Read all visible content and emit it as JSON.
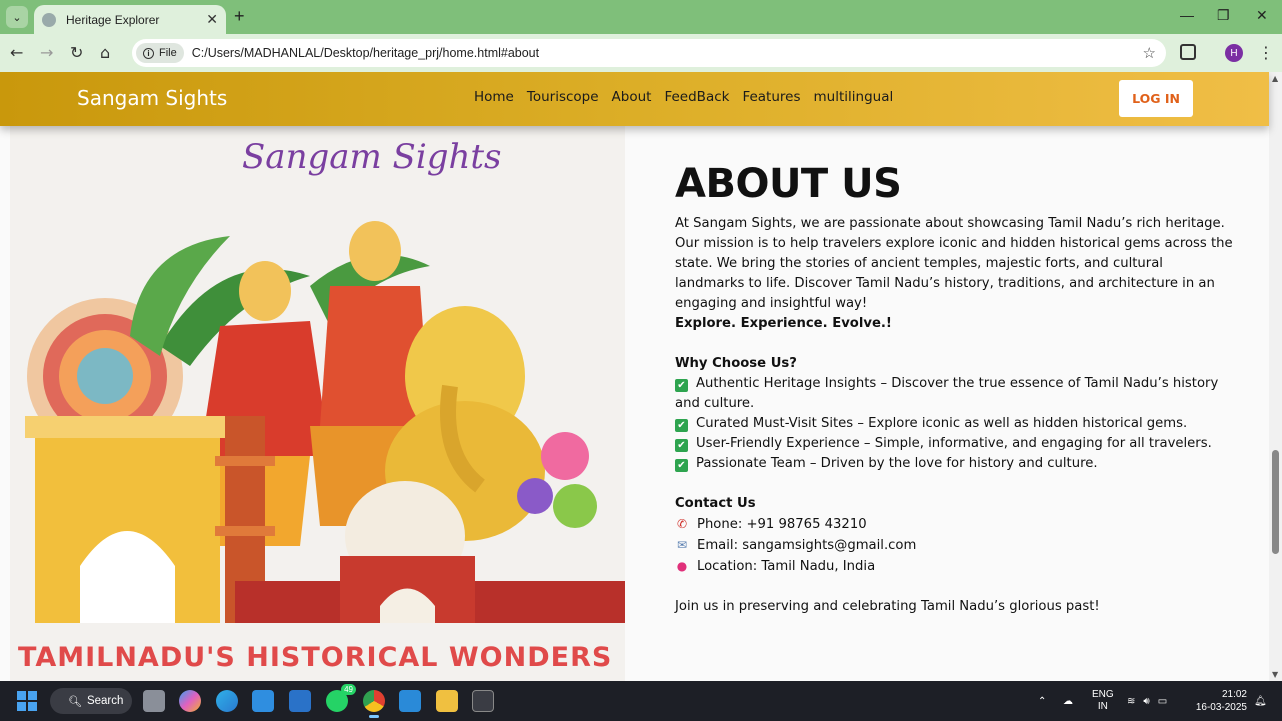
{
  "browser": {
    "tab_title": "Heritage Explorer",
    "tab_close": "✕",
    "new_tab": "+",
    "window_controls": {
      "minimize": "—",
      "maximize": "❐",
      "close": "✕"
    },
    "nav": {
      "back": "←",
      "forward": "→",
      "reload": "↻",
      "home": "⌂"
    },
    "address_chip": "File",
    "address_url": "C:/Users/MADHANLAL/Desktop/heritage_prj/home.html#about",
    "profile_initial": "H"
  },
  "site": {
    "brand": "Sangam Sights",
    "menu": [
      "Home",
      "Touriscope",
      "About",
      "FeedBack",
      "Features",
      "multilingual"
    ],
    "login_label": "LOG IN",
    "hero": {
      "title_text": "Sangam Sights",
      "banner_text": "TAMILNADU'S HISTORICAL WONDERS"
    },
    "about": {
      "heading": "ABOUT US",
      "intro": "At Sangam Sights, we are passionate about showcasing Tamil Nadu’s rich heritage. Our mission is to help travelers explore iconic and hidden historical gems across the state. We bring the stories of ancient temples, majestic forts, and cultural landmarks to life. Discover Tamil Nadu’s history, traditions, and architecture in an engaging and insightful way!",
      "tagline": "Explore. Experience. Evolve.!",
      "why_heading": "Why Choose Us?",
      "why_items": [
        "Authentic Heritage Insights – Discover the true essence of Tamil Nadu’s history and culture.",
        "Curated Must-Visit Sites – Explore iconic as well as hidden historical gems.",
        "User-Friendly Experience – Simple, informative, and engaging for all travelers.",
        "Passionate Team – Driven by the love for history and culture."
      ],
      "contact_heading": "Contact Us",
      "contact": {
        "phone": "Phone: +91 98765 43210",
        "email": "Email: sangamsights@gmail.com",
        "location": "Location: Tamil Nadu, India"
      },
      "closing": "Join us in preserving and celebrating Tamil Nadu’s glorious past!"
    }
  },
  "taskbar": {
    "search_label": "Search",
    "whatsapp_badge": "49",
    "language_top": "ENG",
    "language_bottom": "IN",
    "time": "21:02",
    "date": "16-03-2025"
  },
  "colors": {
    "tabstrip": "#7fbf7a",
    "nav_gradient_start": "#c9980c",
    "nav_gradient_end": "#f0be46",
    "login_text": "#e0611a",
    "check_green": "#2ea44f"
  }
}
